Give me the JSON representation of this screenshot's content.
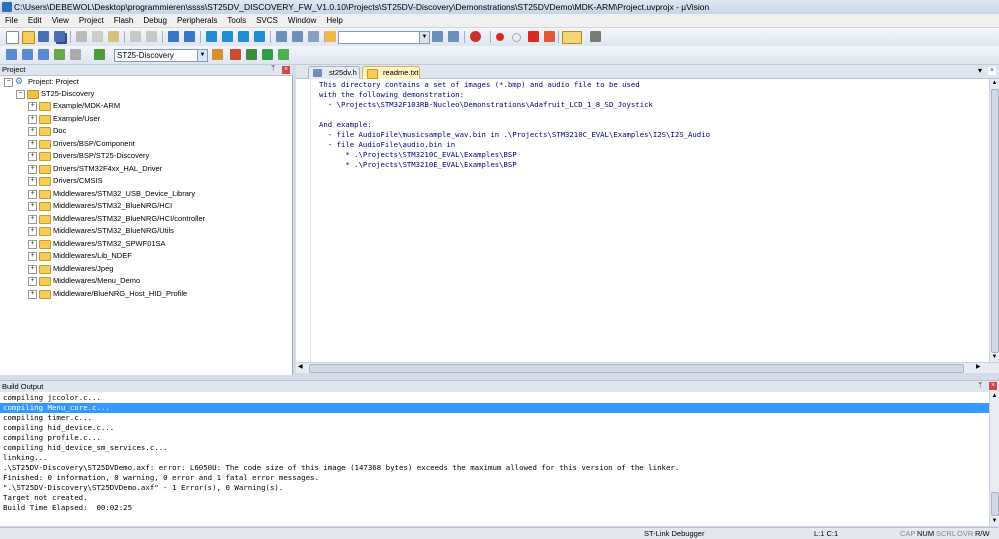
{
  "window": {
    "title": "C:\\Users\\DEBEWOL\\Desktop\\programmieren\\ssss\\ST25DV_DISCOVERY_FW_V1.0.10\\Projects\\ST25DV-Discovery\\Demonstrations\\ST25DVDemo\\MDK-ARM\\Project.uvprojx - µVision"
  },
  "menu": [
    "File",
    "Edit",
    "View",
    "Project",
    "Flash",
    "Debug",
    "Peripherals",
    "Tools",
    "SVCS",
    "Window",
    "Help"
  ],
  "toolbar": {
    "search_value": "",
    "target_value": "ST25-Discovery"
  },
  "project_panel": {
    "title": "Project",
    "root": "Project: Project",
    "target": "ST25-Discovery",
    "groups": [
      "Example/MDK-ARM",
      "Example/User",
      "Doc",
      "Drivers/BSP/Component",
      "Drivers/BSP/ST25-Discovery",
      "Drivers/STM32F4xx_HAL_Driver",
      "Drivers/CMSIS",
      "Middlewares/STM32_USB_Device_Library",
      "Middlewares/STM32_BlueNRG/HCI",
      "Middlewares/STM32_BlueNRG/HCI/controller",
      "Middlewares/STM32_BlueNRG/Utils",
      "Middlewares/STM32_SPWF01SA",
      "Middlewares/Lib_NDEF",
      "Middlewares/Jpeg",
      "Middlewares/Menu_Demo",
      "Middleware/BlueNRG_Host_HID_Profile"
    ]
  },
  "editor": {
    "tabs": [
      {
        "label": "st25dv.h",
        "active": false
      },
      {
        "label": "readme.txt",
        "active": true
      }
    ],
    "lines": [
      "This directory contains a set of images (*.bmp) and audio file to be used",
      "with the following demonstration:",
      "  - \\Projects\\STM32F103RB-Nucleo\\Demonstrations\\Adafruit_LCD_1_8_SD_Joystick",
      "",
      "And example:",
      "  - file AudioFile\\musicsample_wav.bin in .\\Projects\\STM3210C_EVAL\\Examples\\I2S\\I2S_Audio",
      "  - file AudioFile\\audio.bin in",
      "      * .\\Projects\\STM3210C_EVAL\\Examples\\BSP",
      "      * .\\Projects\\STM3210E_EVAL\\Examples\\BSP"
    ]
  },
  "build_output": {
    "title": "Build Output",
    "highlighted_index": 1,
    "lines": [
      "compiling jccolor.c...",
      "compiling Menu_core.c...",
      "compiling timer.c...",
      "compiling hid_device.c...",
      "compiling profile.c...",
      "compiling hid_device_sm_services.c...",
      "linking...",
      ".\\ST25DV-Discovery\\ST25DVDemo.axf: error: L6050U: The code size of this image (147368 bytes) exceeds the maximum allowed for this version of the linker.",
      "Finished: 0 information, 0 warning, 0 error and 1 fatal error messages.",
      "\".\\ST25DV-Discovery\\ST25DVDemo.axf\" - 1 Error(s), 0 Warning(s).",
      "Target not created.",
      "Build Time Elapsed:  00:02:25"
    ]
  },
  "status": {
    "debugger": "ST-Link Debugger",
    "position": "L:1 C:1",
    "cap": "CAP",
    "num": "NUM",
    "scrl": "SCRL",
    "ovr": "OVR",
    "rw": "R/W"
  },
  "colors": {
    "highlight": "#3399ff",
    "editor_text": "#000080",
    "error_close": "#d64541"
  }
}
